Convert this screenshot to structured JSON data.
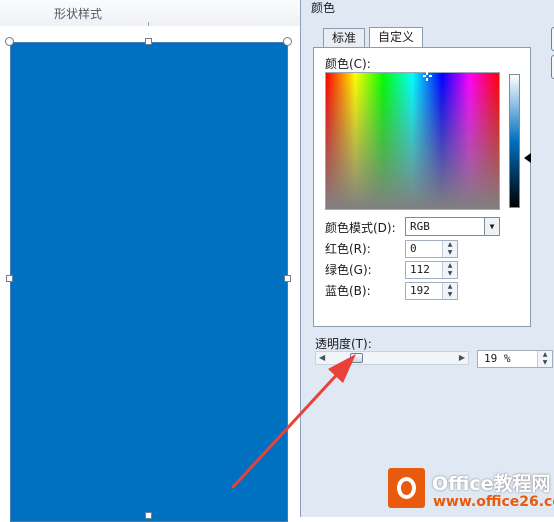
{
  "ribbon": {
    "group_label": "形状样式"
  },
  "shape": {
    "fill_color": "#0070c0"
  },
  "dialog": {
    "title": "颜色",
    "tabs": [
      {
        "label": "标准",
        "active": false
      },
      {
        "label": "自定义",
        "active": true
      }
    ],
    "colors_label": "颜色(C):",
    "color_model_label": "颜色模式(D):",
    "color_model_value": "RGB",
    "red_label": "红色(R):",
    "red_value": "0",
    "green_label": "绿色(G):",
    "green_value": "112",
    "blue_label": "蓝色(B):",
    "blue_value": "192",
    "transparency_label": "透明度(T):",
    "transparency_value": "19 %",
    "transparency_fraction": 0.19
  },
  "annotation": {
    "arrow_color": "#e8413a"
  },
  "watermark": {
    "title": "Office教程网",
    "url": "www.office26.com"
  }
}
